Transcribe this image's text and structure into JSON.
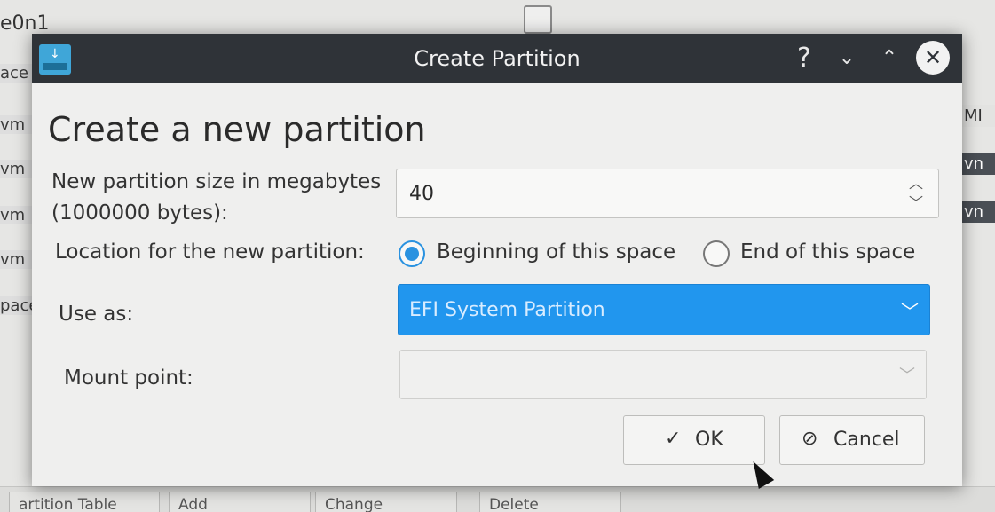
{
  "background": {
    "device": "e0n1",
    "rows": [
      "ace",
      "vm",
      "vm",
      "vm",
      "vm",
      "pace"
    ],
    "right_cells": [
      "MI",
      "vn",
      "vn"
    ],
    "bottom_buttons": [
      "artition Table",
      "Add",
      "Change",
      "Delete"
    ]
  },
  "dialog": {
    "title": "Create Partition",
    "heading": "Create a new partition",
    "titlebar_buttons": {
      "help": "?",
      "minimize": "⌄",
      "maximize": "⌃",
      "close": "✕"
    },
    "size": {
      "label": "New partition size in megabytes (1000000 bytes):",
      "value": "40"
    },
    "location": {
      "label": "Location for the new partition:",
      "options": [
        "Beginning of this space",
        "End of this space"
      ],
      "selected": "Beginning of this space"
    },
    "use_as": {
      "label": "Use as:",
      "value": "EFI System Partition"
    },
    "mount_point": {
      "label": "Mount point:",
      "value": ""
    },
    "buttons": {
      "ok": "OK",
      "cancel": "Cancel"
    }
  },
  "colors": {
    "titlebar": "#2f3338",
    "accent": "#2196ee"
  }
}
